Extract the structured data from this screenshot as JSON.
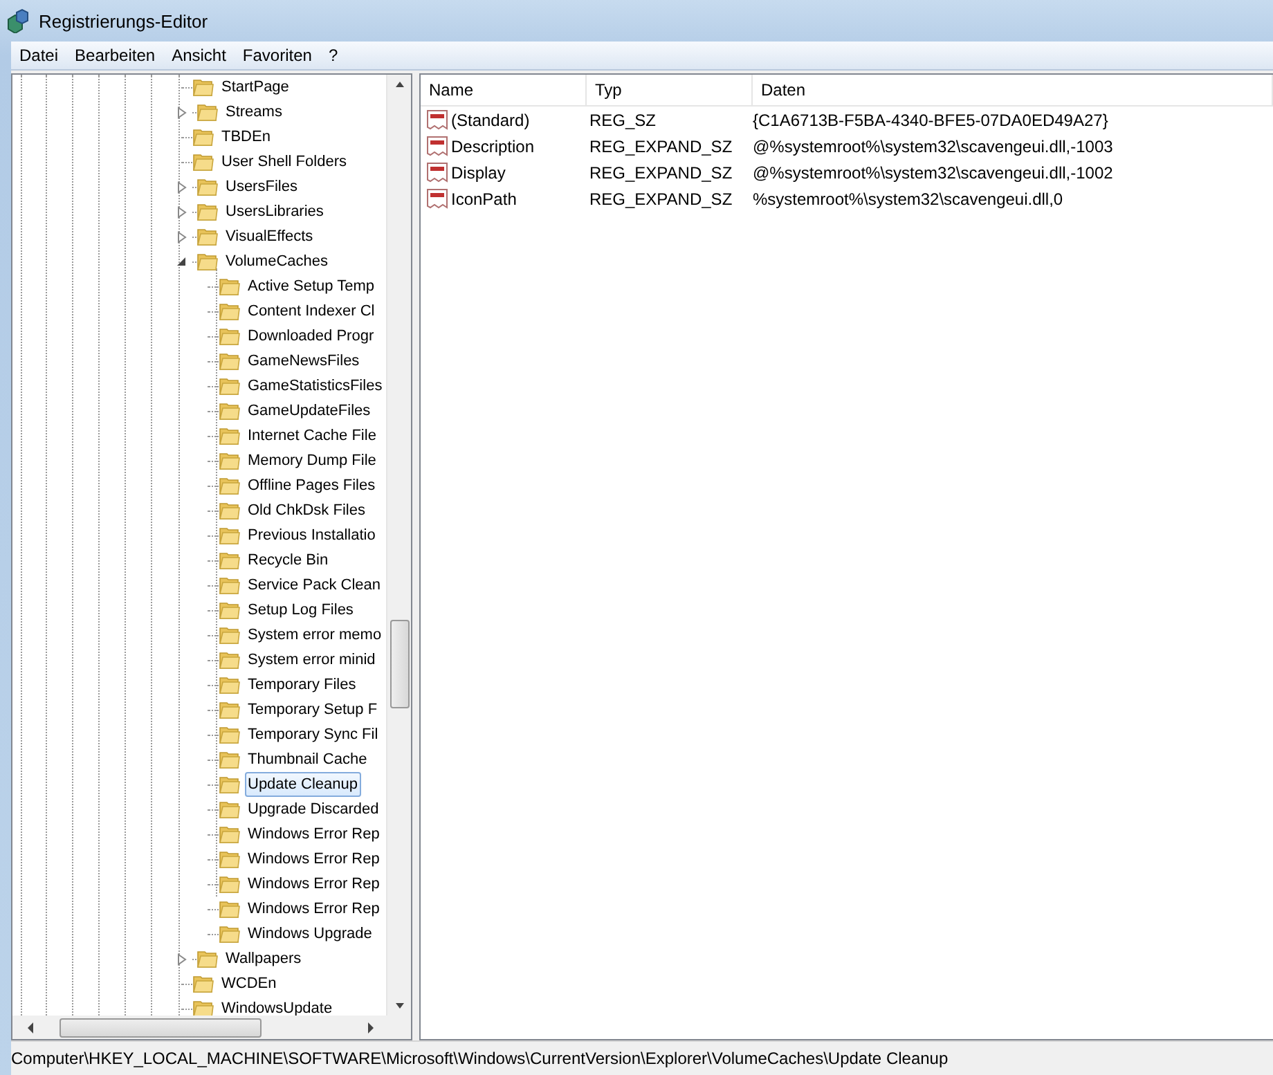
{
  "window": {
    "title": "Registrierungs-Editor"
  },
  "menu": [
    "Datei",
    "Bearbeiten",
    "Ansicht",
    "Favoriten",
    "?"
  ],
  "tree": [
    {
      "label": "StartPage",
      "selected": false
    },
    {
      "label": "Streams",
      "expanded": false,
      "selected": false
    },
    {
      "label": "TBDEn",
      "selected": false
    },
    {
      "label": "User Shell Folders",
      "selected": false
    },
    {
      "label": "UsersFiles",
      "expanded": false,
      "selected": false
    },
    {
      "label": "UsersLibraries",
      "expanded": false,
      "selected": false
    },
    {
      "label": "VisualEffects",
      "expanded": false,
      "selected": false
    },
    {
      "label": "VolumeCaches",
      "expanded": true,
      "selected": false,
      "children": [
        {
          "label": "Active Setup Temp",
          "selected": false
        },
        {
          "label": "Content Indexer Cl",
          "selected": false
        },
        {
          "label": "Downloaded Progr",
          "selected": false
        },
        {
          "label": "GameNewsFiles",
          "selected": false
        },
        {
          "label": "GameStatisticsFiles",
          "selected": false
        },
        {
          "label": "GameUpdateFiles",
          "selected": false
        },
        {
          "label": "Internet Cache File",
          "selected": false
        },
        {
          "label": "Memory Dump File",
          "selected": false
        },
        {
          "label": "Offline Pages Files",
          "selected": false
        },
        {
          "label": "Old ChkDsk Files",
          "selected": false
        },
        {
          "label": "Previous Installatio",
          "selected": false
        },
        {
          "label": "Recycle Bin",
          "selected": false
        },
        {
          "label": "Service Pack Clean",
          "selected": false
        },
        {
          "label": "Setup Log Files",
          "selected": false
        },
        {
          "label": "System error memo",
          "selected": false
        },
        {
          "label": "System error minid",
          "selected": false
        },
        {
          "label": "Temporary Files",
          "selected": false
        },
        {
          "label": "Temporary Setup F",
          "selected": false
        },
        {
          "label": "Temporary Sync Fil",
          "selected": false
        },
        {
          "label": "Thumbnail Cache",
          "selected": false
        },
        {
          "label": "Update Cleanup",
          "selected": true
        },
        {
          "label": "Upgrade Discarded",
          "selected": false
        },
        {
          "label": "Windows Error Rep",
          "selected": false
        },
        {
          "label": "Windows Error Rep",
          "selected": false
        },
        {
          "label": "Windows Error Rep",
          "selected": false
        },
        {
          "label": "Windows Error Rep",
          "selected": false
        },
        {
          "label": "Windows Upgrade",
          "selected": false
        }
      ]
    },
    {
      "label": "Wallpapers",
      "expanded": false,
      "selected": false
    },
    {
      "label": "WCDEn",
      "selected": false
    },
    {
      "label": "WindowsUpdate",
      "selected": false
    }
  ],
  "table": {
    "columns": [
      "Name",
      "Typ",
      "Daten"
    ],
    "rows": [
      {
        "name": "(Standard)",
        "type": "REG_SZ",
        "data": "{C1A6713B-F5BA-4340-BFE5-07DA0ED49A27}"
      },
      {
        "name": "Description",
        "type": "REG_EXPAND_SZ",
        "data": "@%systemroot%\\system32\\scavengeui.dll,-1003"
      },
      {
        "name": "Display",
        "type": "REG_EXPAND_SZ",
        "data": "@%systemroot%\\system32\\scavengeui.dll,-1002"
      },
      {
        "name": "IconPath",
        "type": "REG_EXPAND_SZ",
        "data": "%systemroot%\\system32\\scavengeui.dll,0"
      }
    ]
  },
  "status_bar": "Computer\\HKEY_LOCAL_MACHINE\\SOFTWARE\\Microsoft\\Windows\\CurrentVersion\\Explorer\\VolumeCaches\\Update Cleanup"
}
